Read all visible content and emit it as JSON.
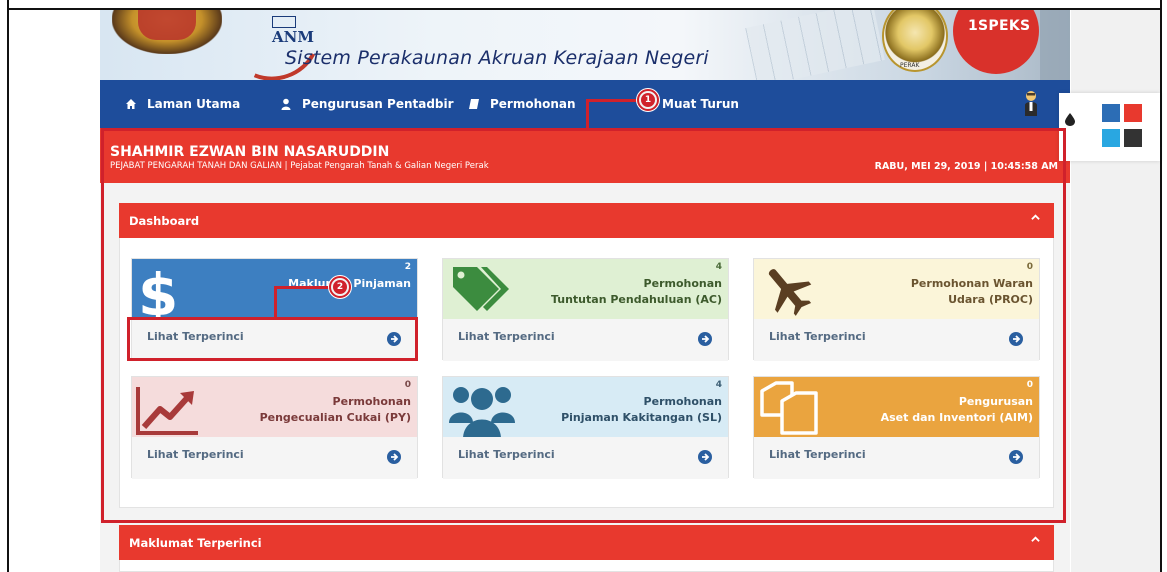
{
  "banner": {
    "anm": "ANM",
    "system_title": "Sistem Perakaunan Akruan Kerajaan Negeri",
    "seal_label": "PERAK",
    "brand_badge": "1SPEKS"
  },
  "nav": {
    "items": [
      {
        "label": "Laman Utama",
        "icon": "home-icon"
      },
      {
        "label": "Pengurusan Pentadbir",
        "icon": "user-icon"
      },
      {
        "label": "Permohonan",
        "icon": "book-icon"
      },
      {
        "label": "Muat Turun",
        "icon": "download-icon"
      }
    ],
    "profile_icon": "user-avatar-icon"
  },
  "user": {
    "name": "SHAHMIR EZWAN BIN NASARUDDIN",
    "office": "PEJABAT PENGARAH TANAH DAN GALIAN | Pejabat Pengarah Tanah & Galian Negeri Perak",
    "datetime": "RABU, MEI 29, 2019 | 10:45:58 AM"
  },
  "dashboard": {
    "title": "Dashboard",
    "cards": [
      {
        "count": "2",
        "title": "Maklumat Pinjaman",
        "link": "Lihat Terperinci",
        "icon": "dollar-icon",
        "theme": "blue"
      },
      {
        "count": "4",
        "title": "Permohonan\nTuntutan Pendahuluan (AC)",
        "link": "Lihat Terperinci",
        "icon": "tags-icon",
        "theme": "green"
      },
      {
        "count": "0",
        "title": "Permohonan Waran\nUdara (PROC)",
        "link": "Lihat Terperinci",
        "icon": "plane-icon",
        "theme": "yellow"
      },
      {
        "count": "0",
        "title": "Permohonan\nPengecualian Cukai (PY)",
        "link": "Lihat Terperinci",
        "icon": "trend-up-icon",
        "theme": "pink"
      },
      {
        "count": "4",
        "title": "Permohonan\nPinjaman Kakitangan (SL)",
        "link": "Lihat Terperinci",
        "icon": "users-icon",
        "theme": "lightblue"
      },
      {
        "count": "0",
        "title": "Pengurusan\nAset dan Inventori (AIM)",
        "link": "Lihat Terperinci",
        "icon": "copy-icon",
        "theme": "orange"
      }
    ]
  },
  "details_panel": {
    "title": "Maklumat Terperinci"
  },
  "annotations": [
    {
      "number": "1"
    },
    {
      "number": "2"
    }
  ],
  "colors": {
    "nav_blue": "#1e4d9b",
    "header_red": "#e8392e",
    "annotation_red": "#d0212b",
    "swatches": [
      "#2c6db5",
      "#e8392e",
      "#29a7e1",
      "#333333"
    ]
  }
}
